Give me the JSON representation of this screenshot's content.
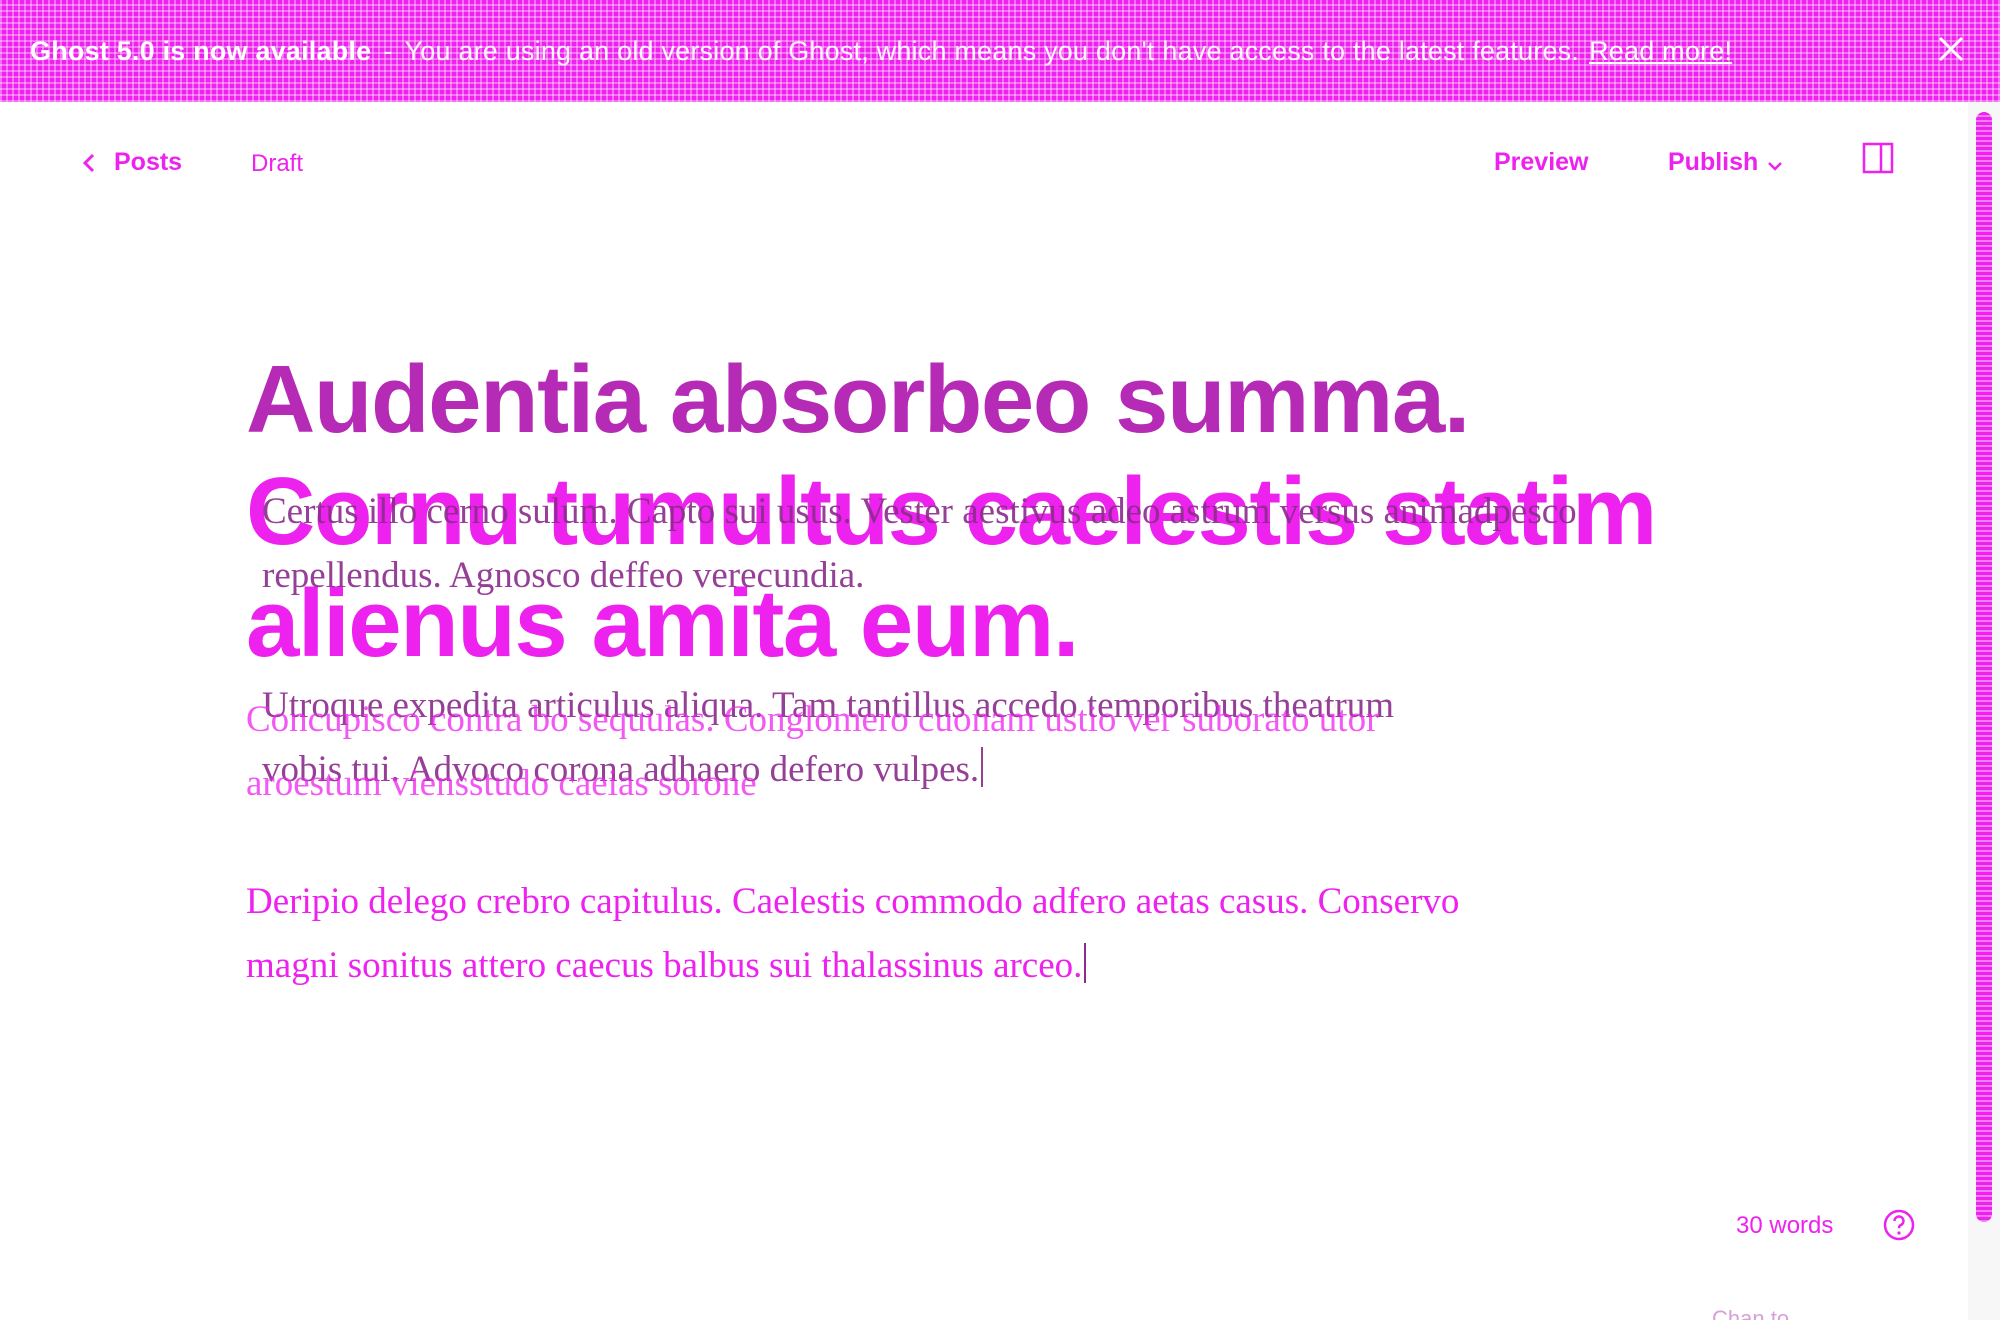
{
  "banner": {
    "title": "Ghost 5.0 is now available",
    "separator": "-",
    "message": "You are using an old version of Ghost, which means you don't have access to the latest features.",
    "link_label": "Read more!",
    "close_icon": "close-icon"
  },
  "header": {
    "back_label": "Posts",
    "status": "Draft",
    "preview_label": "Preview",
    "publish_label": "Publish",
    "sidebar_icon": "sidebar-toggle-icon"
  },
  "post": {
    "title_line1": "Audentia absorbeo summa.",
    "title_line2": "Cornu tumultus caelestis statim",
    "title_line3": "alienus amita eum.",
    "ghost_para1_line1": "Certus illo cerno sulum. Capto sui usus. Vester aestivus adeo astrum versus animadpesco",
    "ghost_para1_line2": "repellendus. Agnosco deffeo verecundia.",
    "ghost_para2_line1": "Utroque expedita articulus aliqua. Tam tantillus accedo temporibus theatrum",
    "ghost_para2_line2": "vobis tui. Advoco corona adhaero defero vulpes.",
    "overlay_para_line1": "Concupisco contra bo sequulas. Conglomero cuonam ustio ver suborato utor",
    "overlay_para_line2": "aroestum viensstudo caeias sorone",
    "body_line1": "Deripio delego crebro capitulus. Caelestis commodo adfero aetas casus. Conservo",
    "body_line2": "magni sonitus attero caecus balbus sui thalassinus arceo."
  },
  "footer": {
    "word_count": "30 words",
    "help_icon": "help-icon",
    "partial_text": "Chan to"
  },
  "colors": {
    "accent": "#ee22ee",
    "dark_accent": "#8b2b8b"
  }
}
